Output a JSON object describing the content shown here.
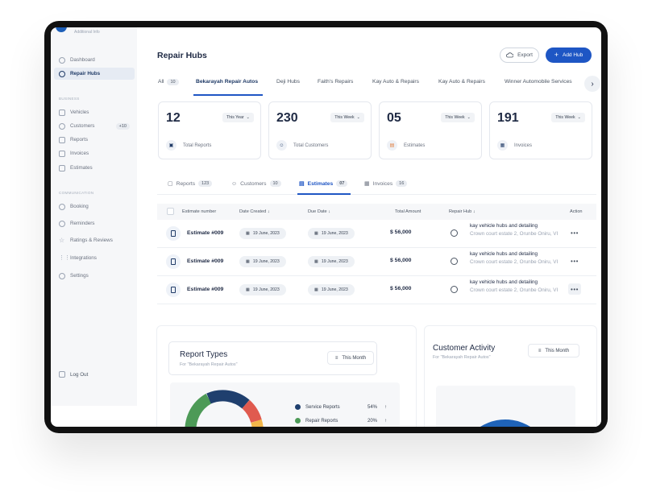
{
  "sidebar": {
    "profile_sub": "Additional Info",
    "items_top": [
      {
        "label": "Dashboard",
        "icon": "dashboard-icon"
      },
      {
        "label": "Repair Hubs",
        "icon": "hub-icon",
        "active": true
      }
    ],
    "section_business": "BUSINESS",
    "items_business": [
      {
        "label": "Vehicles",
        "icon": "vehicle-icon"
      },
      {
        "label": "Customers",
        "icon": "customers-icon",
        "badge": "+10"
      },
      {
        "label": "Reports",
        "icon": "reports-icon"
      },
      {
        "label": "Invoices",
        "icon": "invoice-icon"
      },
      {
        "label": "Estimates",
        "icon": "estimate-icon"
      }
    ],
    "section_communication": "COMMUNICATION",
    "items_communication": [
      {
        "label": "Booking",
        "icon": "booking-icon"
      },
      {
        "label": "Reminders",
        "icon": "bell-icon"
      },
      {
        "label": "Ratings & Reviews",
        "icon": "star-icon"
      },
      {
        "label": "Integrations",
        "icon": "grid-icon"
      },
      {
        "label": "Settings",
        "icon": "gear-icon"
      }
    ],
    "logout": "Log Out"
  },
  "header": {
    "title": "Repair Hubs",
    "export_label": "Export",
    "add_label": "Add Hub"
  },
  "hub_tabs": {
    "all_label": "All",
    "all_count": "10",
    "tabs": [
      "Bekarayah Repair Autos",
      "Deji Hubs",
      "Faith's Repairs",
      "Kay Auto & Repairs",
      "Kay Auto & Repairs",
      "Winner Automobile Services"
    ]
  },
  "stats": [
    {
      "value": "12",
      "period": "This Year",
      "label": "Total Reports"
    },
    {
      "value": "230",
      "period": "This Week",
      "label": "Total Customers"
    },
    {
      "value": "05",
      "period": "This Week",
      "label": "Estimates"
    },
    {
      "value": "191",
      "period": "This Week",
      "label": "Invoices"
    }
  ],
  "sub_tabs": [
    {
      "label": "Reports",
      "count": "123"
    },
    {
      "label": "Customers",
      "count": "10"
    },
    {
      "label": "Estimates",
      "count": "07"
    },
    {
      "label": "Invoices",
      "count": "16"
    }
  ],
  "table": {
    "headers": {
      "estimate": "Estimate number",
      "date_created": "Date Created",
      "due_date": "Due Date",
      "amount": "Total Amount",
      "hub": "Repair Hub",
      "action": "Action"
    },
    "rows": [
      {
        "estimate": "Estimate #009",
        "date_created": "19 June, 2023",
        "due_date": "19 June, 2023",
        "amount": "$ 56,000",
        "hub_name": "kay vehicle hubs and detailing",
        "hub_addr": "Crown court estate 2, Orunbe Oniru, VI"
      },
      {
        "estimate": "Estimate #009",
        "date_created": "19 June, 2023",
        "due_date": "19 June, 2023",
        "amount": "$ 56,000",
        "hub_name": "kay vehicle hubs and detailing",
        "hub_addr": "Crown court estate 2, Orunbe Oniru, VI"
      },
      {
        "estimate": "Estimate #009",
        "date_created": "19 June, 2023",
        "due_date": "19 June, 2023",
        "amount": "$ 56,000",
        "hub_name": "kay vehicle hubs and detailing",
        "hub_addr": "Crown court estate 2, Orunbe Oniru, VI"
      }
    ]
  },
  "report_types": {
    "title": "Report Types",
    "subtitle": "For \"Bekarayah Repair Autos\"",
    "filter": "This Month",
    "legend": [
      {
        "label": "Service Reports",
        "pct": "54%",
        "color": "#1f3f6e"
      },
      {
        "label": "Repair Reports",
        "pct": "20%",
        "color": "#4d9a57"
      }
    ]
  },
  "customer_activity": {
    "title": "Customer Activity",
    "subtitle": "For \"Bekarayah Repair Autos\"",
    "filter": "This Month"
  }
}
